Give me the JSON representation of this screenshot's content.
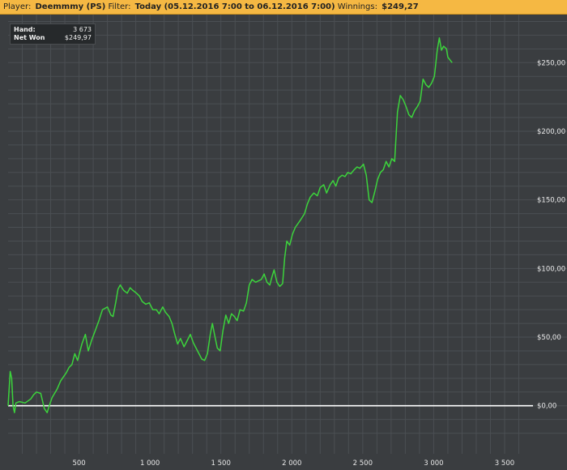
{
  "header": {
    "player_label": "Player:",
    "player_value": "Deemmmy (PS)",
    "filter_label": "Filter:",
    "filter_value": "Today (05.12.2016 7:00 to 06.12.2016 7:00)",
    "winnings_label": "Winnings:",
    "winnings_value": "$249,27"
  },
  "tooltip": {
    "hand_label": "Hand:",
    "hand_value": "3 673",
    "net_label": "Net Won",
    "net_value": "$249,97"
  },
  "colors": {
    "background": "#3a3d40",
    "grid": "#4b4f53",
    "line": "#3cd33c",
    "zero_line": "#ffffff",
    "header": "#f5b843"
  },
  "chart_data": {
    "type": "line",
    "grid": true,
    "xlim": [
      0,
      3700
    ],
    "ylim": [
      -35,
      285
    ],
    "x_ticks": [
      500,
      1000,
      1500,
      2000,
      2500,
      3000,
      3500
    ],
    "x_tick_labels": [
      "500",
      "1 000",
      "1 500",
      "2 000",
      "2 500",
      "3 000",
      "3 500"
    ],
    "y_ticks": [
      0,
      50,
      100,
      150,
      200,
      250
    ],
    "y_tick_labels": [
      "$0,00",
      "$50,00",
      "$100,00",
      "$150,00",
      "$200,00",
      "$250,00"
    ],
    "series": [
      {
        "points": [
          [
            0,
            0
          ],
          [
            15,
            25
          ],
          [
            25,
            20
          ],
          [
            35,
            0
          ],
          [
            45,
            -5
          ],
          [
            55,
            2
          ],
          [
            80,
            3
          ],
          [
            120,
            2
          ],
          [
            160,
            5
          ],
          [
            180,
            8
          ],
          [
            200,
            10
          ],
          [
            230,
            9
          ],
          [
            255,
            -2
          ],
          [
            275,
            -5
          ],
          [
            290,
            0
          ],
          [
            310,
            6
          ],
          [
            345,
            12
          ],
          [
            370,
            18
          ],
          [
            390,
            21
          ],
          [
            410,
            24
          ],
          [
            430,
            28
          ],
          [
            450,
            30
          ],
          [
            470,
            38
          ],
          [
            490,
            33
          ],
          [
            520,
            45
          ],
          [
            545,
            52
          ],
          [
            565,
            40
          ],
          [
            590,
            48
          ],
          [
            615,
            55
          ],
          [
            640,
            62
          ],
          [
            665,
            70
          ],
          [
            700,
            72
          ],
          [
            725,
            66
          ],
          [
            740,
            65
          ],
          [
            760,
            76
          ],
          [
            775,
            85
          ],
          [
            790,
            88
          ],
          [
            815,
            84
          ],
          [
            840,
            82
          ],
          [
            860,
            86
          ],
          [
            880,
            84
          ],
          [
            905,
            82
          ],
          [
            925,
            80
          ],
          [
            945,
            76
          ],
          [
            970,
            74
          ],
          [
            995,
            75
          ],
          [
            1020,
            70
          ],
          [
            1045,
            70
          ],
          [
            1065,
            67
          ],
          [
            1090,
            72
          ],
          [
            1110,
            68
          ],
          [
            1135,
            65
          ],
          [
            1155,
            60
          ],
          [
            1175,
            52
          ],
          [
            1195,
            45
          ],
          [
            1215,
            49
          ],
          [
            1240,
            43
          ],
          [
            1260,
            47
          ],
          [
            1285,
            52
          ],
          [
            1305,
            46
          ],
          [
            1325,
            42
          ],
          [
            1345,
            38
          ],
          [
            1365,
            34
          ],
          [
            1385,
            33
          ],
          [
            1405,
            38
          ],
          [
            1425,
            52
          ],
          [
            1440,
            60
          ],
          [
            1455,
            52
          ],
          [
            1475,
            42
          ],
          [
            1495,
            40
          ],
          [
            1515,
            55
          ],
          [
            1535,
            66
          ],
          [
            1555,
            60
          ],
          [
            1575,
            67
          ],
          [
            1595,
            65
          ],
          [
            1615,
            62
          ],
          [
            1635,
            70
          ],
          [
            1660,
            69
          ],
          [
            1680,
            75
          ],
          [
            1700,
            88
          ],
          [
            1720,
            92
          ],
          [
            1745,
            90
          ],
          [
            1765,
            91
          ],
          [
            1785,
            92
          ],
          [
            1805,
            96
          ],
          [
            1825,
            90
          ],
          [
            1845,
            88
          ],
          [
            1860,
            94
          ],
          [
            1875,
            99
          ],
          [
            1895,
            90
          ],
          [
            1915,
            87
          ],
          [
            1935,
            89
          ],
          [
            1950,
            108
          ],
          [
            1965,
            120
          ],
          [
            1985,
            117
          ],
          [
            2005,
            125
          ],
          [
            2025,
            130
          ],
          [
            2045,
            133
          ],
          [
            2065,
            136
          ],
          [
            2090,
            140
          ],
          [
            2110,
            147
          ],
          [
            2130,
            152
          ],
          [
            2155,
            155
          ],
          [
            2180,
            153
          ],
          [
            2200,
            159
          ],
          [
            2225,
            161
          ],
          [
            2245,
            155
          ],
          [
            2270,
            161
          ],
          [
            2290,
            164
          ],
          [
            2310,
            160
          ],
          [
            2330,
            166
          ],
          [
            2355,
            168
          ],
          [
            2375,
            167
          ],
          [
            2395,
            170
          ],
          [
            2415,
            169
          ],
          [
            2440,
            172
          ],
          [
            2460,
            174
          ],
          [
            2480,
            173
          ],
          [
            2505,
            176
          ],
          [
            2525,
            168
          ],
          [
            2545,
            150
          ],
          [
            2565,
            148
          ],
          [
            2585,
            156
          ],
          [
            2605,
            165
          ],
          [
            2625,
            170
          ],
          [
            2645,
            172
          ],
          [
            2665,
            178
          ],
          [
            2685,
            174
          ],
          [
            2705,
            180
          ],
          [
            2725,
            178
          ],
          [
            2745,
            214
          ],
          [
            2765,
            226
          ],
          [
            2785,
            223
          ],
          [
            2805,
            218
          ],
          [
            2825,
            212
          ],
          [
            2845,
            210
          ],
          [
            2865,
            215
          ],
          [
            2885,
            218
          ],
          [
            2905,
            222
          ],
          [
            2925,
            238
          ],
          [
            2945,
            234
          ],
          [
            2965,
            232
          ],
          [
            2985,
            235
          ],
          [
            3005,
            240
          ],
          [
            3025,
            259
          ],
          [
            3040,
            268
          ],
          [
            3055,
            259
          ],
          [
            3070,
            262
          ],
          [
            3090,
            260
          ],
          [
            3100,
            254
          ],
          [
            3115,
            252
          ],
          [
            3130,
            250
          ]
        ]
      }
    ]
  }
}
